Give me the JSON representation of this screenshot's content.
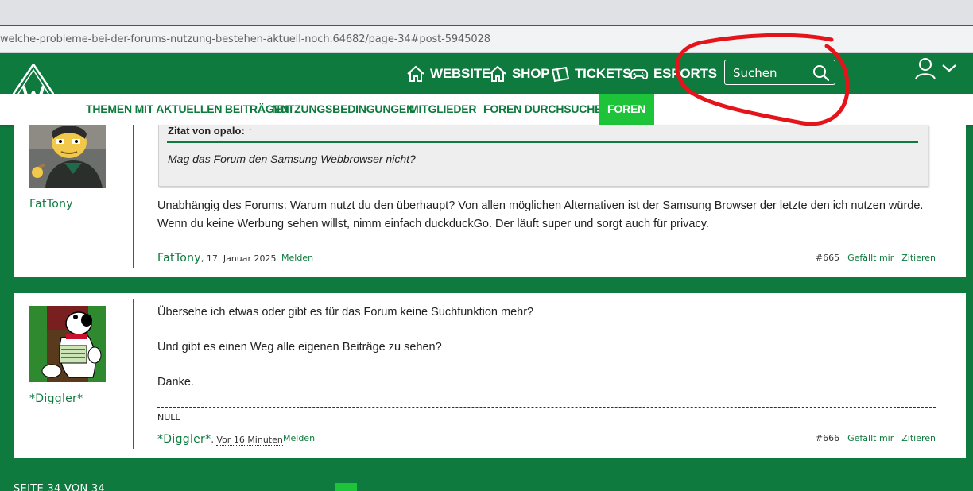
{
  "browser": {
    "url": "welche-probleme-bei-der-forums-nutzung-bestehen-aktuell-noch.64682/page-34#post-5945028"
  },
  "header": {
    "links": [
      {
        "label": "WEBSITE",
        "icon": "home-icon"
      },
      {
        "label": "SHOP",
        "icon": "home-icon"
      },
      {
        "label": "TICKETS",
        "icon": "ticket-icon"
      },
      {
        "label": "ESPORTS",
        "icon": "gamepad-icon"
      }
    ],
    "search": {
      "placeholder": "Suchen",
      "icon": "search-icon"
    },
    "user_icon": "user-icon"
  },
  "subnav": {
    "items": [
      "THEMEN MIT AKTUELLEN BEITRÄGEN",
      "NUTZUNGSBEDINGUNGEN",
      "MITGLIEDER",
      "FOREN DURCHSUCHEN",
      "FOREN"
    ],
    "active": "FOREN"
  },
  "posts": [
    {
      "username": "FatTony",
      "quote": {
        "header": "Zitat von opalo:",
        "arrow": "↑",
        "text": "Mag das Forum den Samsung Webbrowser nicht?"
      },
      "message_lines": [
        "Unabhängig des Forums: Warum nutzt du den überhaupt? Von allen möglichen Alternativen ist der Samsung Browser der letzte den ich nutzen würde.",
        "Wenn du keine Werbung sehen willst, nimm einfach duckduckGo. Der läuft super und sorgt auch für privacy."
      ],
      "author": "FatTony",
      "date": "17. Januar 2025",
      "report": "Melden",
      "number": "#665",
      "like": "Gefällt mir",
      "quote_action": "Zitieren"
    },
    {
      "username": "*Diggler*",
      "message_lines": [
        "Übersehe ich etwas oder gibt es für das Forum keine Suchfunktion mehr?",
        "Und gibt es einen Weg alle eigenen Beiträge zu sehen?",
        "Danke."
      ],
      "signature": "NULL",
      "author": "*Diggler*",
      "date": "Vor 16 Minuten",
      "report": "Melden",
      "number": "#666",
      "like": "Gefällt mir",
      "quote_action": "Zitieren"
    }
  ],
  "pagination": {
    "label": "SEITE 34 VON 34"
  },
  "colors": {
    "brand_green": "#0e7a3d",
    "active_green": "#1dc43a",
    "annotation_red": "#e5141a"
  }
}
